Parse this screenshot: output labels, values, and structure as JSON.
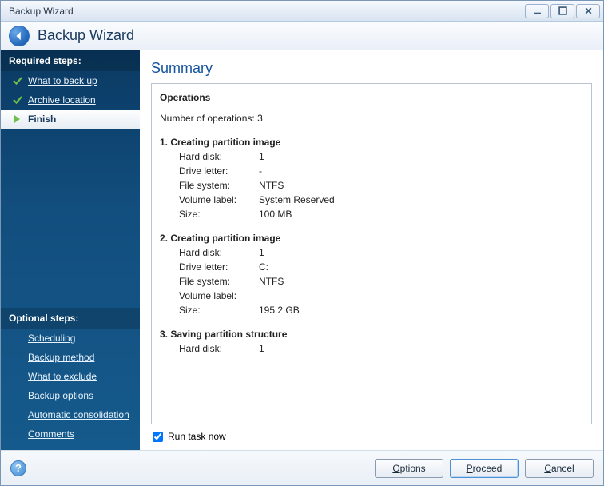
{
  "window": {
    "title": "Backup Wizard"
  },
  "header": {
    "title": "Backup Wizard"
  },
  "sidebar": {
    "required_header": "Required steps:",
    "required": [
      {
        "label": "What to back up",
        "state": "done"
      },
      {
        "label": "Archive location",
        "state": "done"
      },
      {
        "label": "Finish",
        "state": "current"
      }
    ],
    "optional_header": "Optional steps:",
    "optional": [
      {
        "label": "Scheduling"
      },
      {
        "label": "Backup method"
      },
      {
        "label": "What to exclude"
      },
      {
        "label": "Backup options"
      },
      {
        "label": "Automatic consolidation"
      },
      {
        "label": "Comments"
      }
    ]
  },
  "summary": {
    "heading": "Summary",
    "ops_header": "Operations",
    "count_label": "Number of operations:",
    "count": "3",
    "operations": [
      {
        "title": "1. Creating partition image",
        "rows": [
          {
            "k": "Hard disk:",
            "v": "1"
          },
          {
            "k": "Drive letter:",
            "v": "-"
          },
          {
            "k": "File system:",
            "v": "NTFS"
          },
          {
            "k": "Volume label:",
            "v": "System Reserved"
          },
          {
            "k": "Size:",
            "v": "100 MB"
          }
        ]
      },
      {
        "title": "2. Creating partition image",
        "rows": [
          {
            "k": "Hard disk:",
            "v": "1"
          },
          {
            "k": "Drive letter:",
            "v": "C:"
          },
          {
            "k": "File system:",
            "v": "NTFS"
          },
          {
            "k": "Volume label:",
            "v": ""
          },
          {
            "k": "Size:",
            "v": "195.2 GB"
          }
        ]
      },
      {
        "title": "3. Saving partition structure",
        "rows": [
          {
            "k": "Hard disk:",
            "v": "1"
          }
        ]
      }
    ],
    "run_task_label": "Run task now",
    "run_task_checked": true
  },
  "footer": {
    "options": "Options",
    "proceed": "Proceed",
    "cancel": "Cancel"
  }
}
